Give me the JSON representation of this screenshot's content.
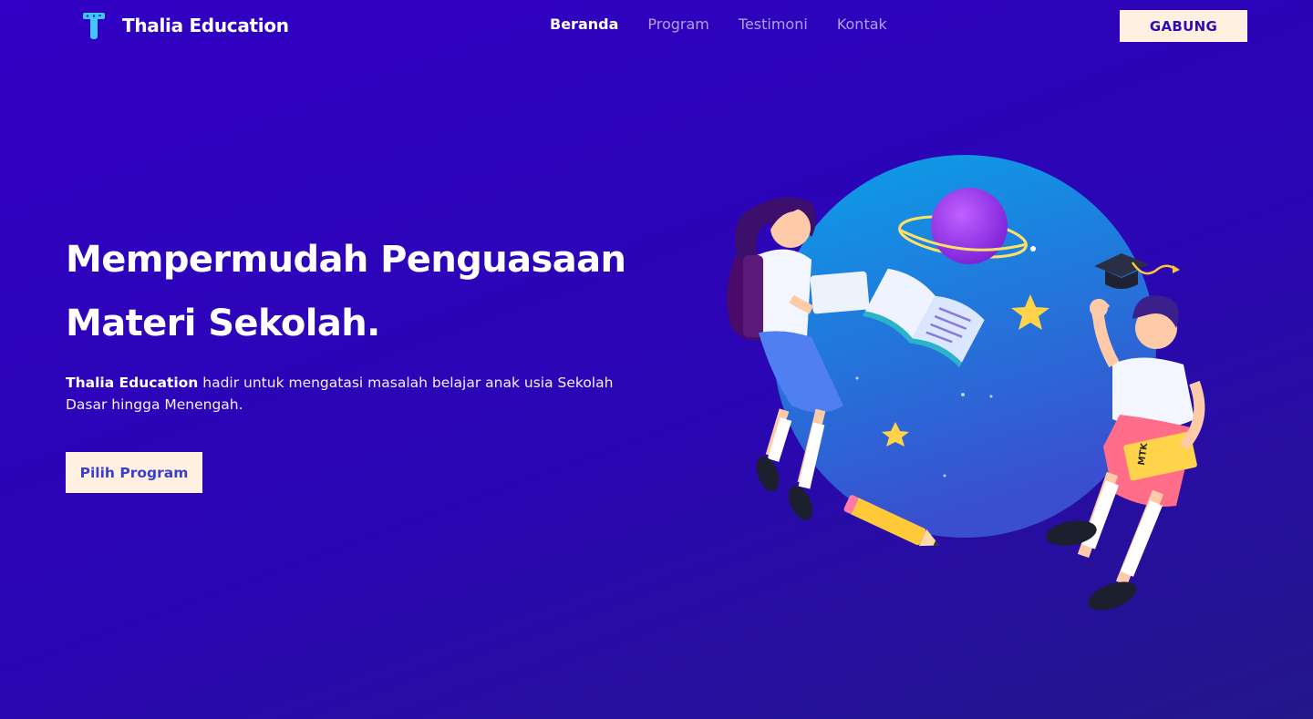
{
  "nav": {
    "brand_name": "Thalia Education",
    "links": [
      {
        "label": "Beranda",
        "active": true
      },
      {
        "label": "Program",
        "active": false
      },
      {
        "label": "Testimoni",
        "active": false
      },
      {
        "label": "Kontak",
        "active": false
      }
    ],
    "join_label": "GABUNG"
  },
  "hero": {
    "title_line1": "Mempermudah Penguasaan",
    "title_line2": "Materi Sekolah.",
    "desc_brand": "Thalia Education",
    "desc_rest": " hadir untuk mengatasi masalah belajar anak usia Sekolah Dasar hingga Menengah.",
    "cta_label": "Pilih Program"
  },
  "illustration": {
    "book_label": "MTK"
  },
  "colors": {
    "background": "#3200c4",
    "button_bg": "#fff0e0",
    "join_text": "#2f0bb0",
    "cta_text": "#3a3fd0",
    "logo": "#3fc7ff"
  }
}
